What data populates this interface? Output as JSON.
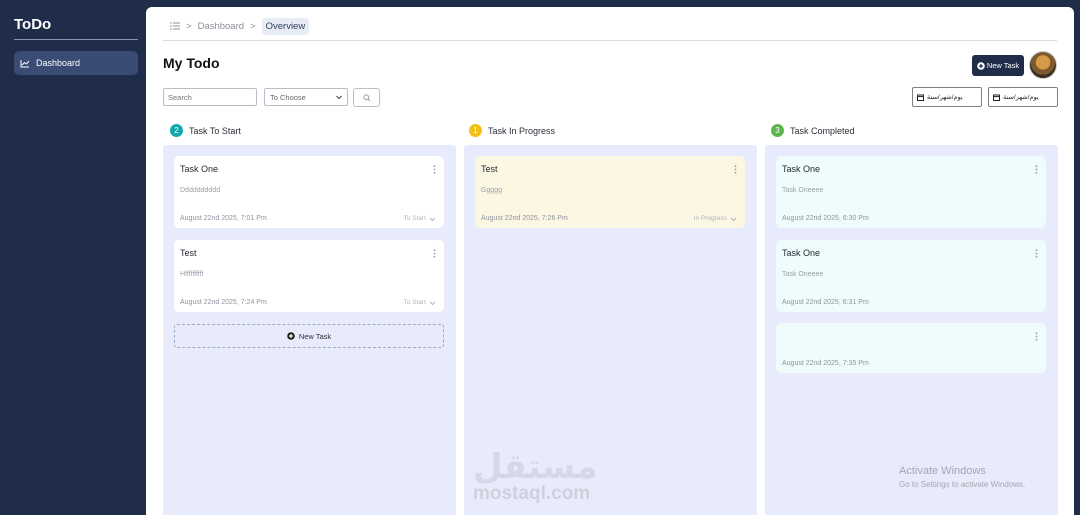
{
  "sidebar": {
    "brand": "ToDo",
    "items": [
      {
        "label": "Dashboard",
        "icon": "chart-line-icon"
      }
    ]
  },
  "breadcrumb": {
    "items": [
      "Dashboard",
      "Overview"
    ],
    "separator": ">"
  },
  "header": {
    "title": "My Todo",
    "new_task_label": "New Task"
  },
  "filters": {
    "search_placeholder": "Search",
    "select_value": "To Choose",
    "date_from": "يوم/شهر/سنة",
    "date_to": "يوم/شهر/سنة"
  },
  "columns": [
    {
      "title": "Task To Start",
      "count": "2",
      "badge_color": "#14a7ae",
      "cards": [
        {
          "title": "Task One",
          "desc": "Dddddddddd",
          "date": "August 22nd 2025, 7:01 Pm",
          "status": "To Start"
        },
        {
          "title": "Test",
          "desc": "Hffffffffff",
          "date": "August 22nd 2025, 7:24 Pm",
          "status": "To Start"
        }
      ],
      "add_label": "New Task"
    },
    {
      "title": "Task In Progress",
      "count": "1",
      "badge_color": "#f2c114",
      "cards": [
        {
          "title": "Test",
          "desc": "Ggggg",
          "date": "August 22nd 2025, 7:26 Pm",
          "status": "In Progress"
        }
      ]
    },
    {
      "title": "Task Completed",
      "count": "3",
      "badge_color": "#5bb64b",
      "cards": [
        {
          "title": "Task One",
          "desc": "Task Oneeee",
          "date": "August 22nd 2025, 6:30 Pm"
        },
        {
          "title": "Task One",
          "desc": "Task Oneeee",
          "date": "August 22nd 2025, 6:31 Pm"
        },
        {
          "title": "",
          "desc": "",
          "date": "August 22nd 2025, 7:35 Pm"
        }
      ]
    }
  ],
  "watermark": {
    "arabic": "مستقل",
    "latin": "mostaql.com"
  },
  "activation": {
    "title": "Activate Windows",
    "subtitle": "Go to Settings to activate Windows."
  }
}
